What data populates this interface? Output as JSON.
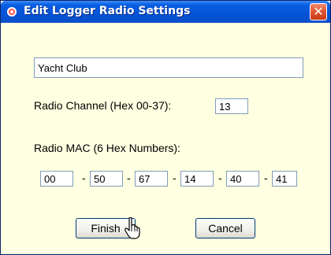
{
  "window": {
    "title": "Edit Logger Radio Settings",
    "close_glyph": "✕"
  },
  "form": {
    "name_value": "Yacht Club",
    "channel_label": "Radio Channel (Hex 00-37):",
    "channel_value": "13",
    "mac_label": "Radio MAC (6 Hex Numbers):",
    "mac_separator": "-",
    "mac_octets": [
      "00",
      "50",
      "67",
      "14",
      "40",
      "41"
    ]
  },
  "buttons": {
    "finish_label": "Finish",
    "cancel_label": "Cancel"
  },
  "icons": {
    "title_icon": "app-icon",
    "close_icon": "close-icon",
    "cursor_icon": "hand-pointer-icon"
  },
  "colors": {
    "titlebar": "#0453d6",
    "body": "#ffffe1",
    "close": "#e0542f"
  }
}
